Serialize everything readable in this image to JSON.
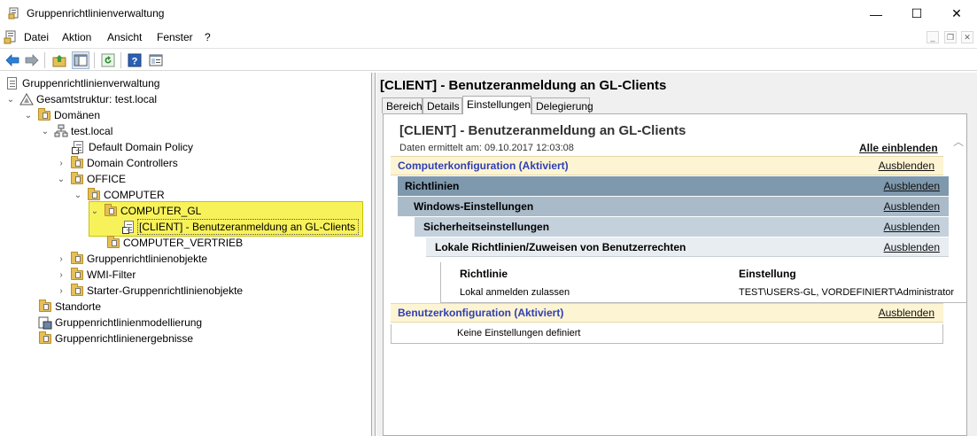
{
  "window": {
    "title": "Gruppenrichtlinienverwaltung",
    "min_glyph": "—",
    "max_glyph": "☐",
    "close_glyph": "✕"
  },
  "menu": {
    "items": [
      "Datei",
      "Aktion",
      "Ansicht",
      "Fenster",
      "?"
    ]
  },
  "mdi": {
    "min": "_",
    "restore": "❐",
    "close": "✕"
  },
  "toolbar": {
    "icons": [
      "back-arrow-icon",
      "forward-arrow-icon",
      "up-folder-icon",
      "show-hide-tree-icon",
      "refresh-icon",
      "help-icon",
      "properties-icon"
    ]
  },
  "tree": {
    "root": "Gruppenrichtlinienverwaltung",
    "forest": "Gesamtstruktur: test.local",
    "domains": "Domänen",
    "domain": "test.local",
    "default_policy": "Default Domain Policy",
    "domain_controllers": "Domain Controllers",
    "office": "OFFICE",
    "computer": "COMPUTER",
    "computer_gl": "COMPUTER_GL",
    "client_gpo": "[CLIENT] - Benutzeranmeldung an GL-Clients",
    "computer_vertrieb": "COMPUTER_VERTRIEB",
    "gpo_objects": "Gruppenrichtlinienobjekte",
    "wmi_filter": "WMI-Filter",
    "starter_gpo": "Starter-Gruppenrichtlinienobjekte",
    "sites": "Standorte",
    "modeling": "Gruppenrichtlinienmodellierung",
    "results": "Gruppenrichtlinienergebnisse"
  },
  "right": {
    "title": "[CLIENT] - Benutzeranmeldung an GL-Clients",
    "tabs": [
      "Bereich",
      "Details",
      "Einstellungen",
      "Delegierung"
    ],
    "active_tab": "Einstellungen",
    "report": {
      "title": "[CLIENT] - Benutzeranmeldung an GL-Clients",
      "date": "Daten ermittelt am: 09.10.2017 12:03:08",
      "show_all": "Alle einblenden",
      "hide": "Ausblenden",
      "computer_config": "Computerkonfiguration (Aktiviert)",
      "policies": "Richtlinien",
      "windows_settings": "Windows-Einstellungen",
      "security_settings": "Sicherheitseinstellungen",
      "local_policies": "Lokale Richtlinien/Zuweisen von Benutzerrechten",
      "table": {
        "headers": [
          "Richtlinie",
          "Einstellung"
        ],
        "rows": [
          [
            "Lokal anmelden zulassen",
            "TEST\\USERS-GL, VORDEFINIERT\\Administrator"
          ]
        ]
      },
      "user_config": "Benutzerkonfiguration (Aktiviert)",
      "no_settings": "Keine Einstellungen definiert"
    }
  }
}
